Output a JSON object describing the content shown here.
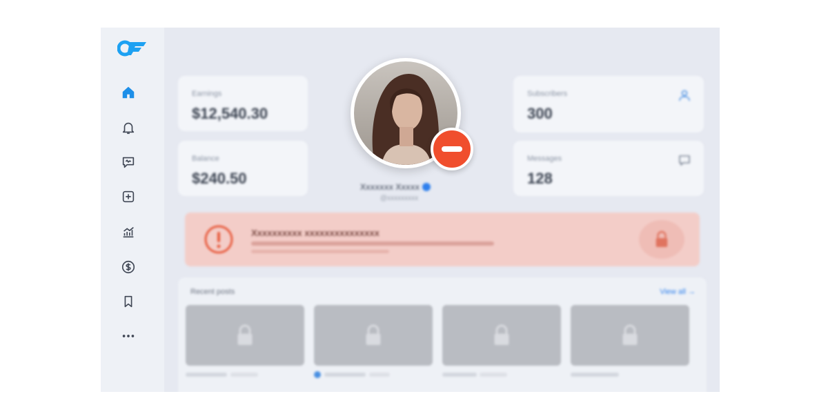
{
  "brand": {
    "logo_text": "OF",
    "accent": "#1da1f2"
  },
  "sidebar": {
    "items": [
      {
        "icon": "home-icon",
        "active": true
      },
      {
        "icon": "bell-icon"
      },
      {
        "icon": "message-icon"
      },
      {
        "icon": "add-post-icon"
      },
      {
        "icon": "stats-icon"
      },
      {
        "icon": "dollar-icon"
      },
      {
        "icon": "bookmark-icon"
      },
      {
        "icon": "more-icon"
      }
    ]
  },
  "stats": {
    "earnings": {
      "label": "Earnings",
      "value": "$12,540.30"
    },
    "balance": {
      "label": "Balance",
      "value": "$240.50"
    },
    "subscribers": {
      "label": "Subscribers",
      "value": "300"
    },
    "messages": {
      "label": "Messages",
      "value": "128"
    }
  },
  "profile": {
    "name": "Xxxxxxx Xxxxx",
    "handle": "@xxxxxxxxx",
    "verified": true,
    "status_badge": "blocked",
    "badge_color": "#f04e2d"
  },
  "alert": {
    "title": "Xxxxxxxxxx xxxxxxxxxxxxxxx",
    "color": "#f3cdc8"
  },
  "recent_posts": {
    "title": "Recent posts",
    "view_all": "View all",
    "items": [
      {
        "locked": true
      },
      {
        "locked": true
      },
      {
        "locked": true
      },
      {
        "locked": true
      }
    ]
  }
}
